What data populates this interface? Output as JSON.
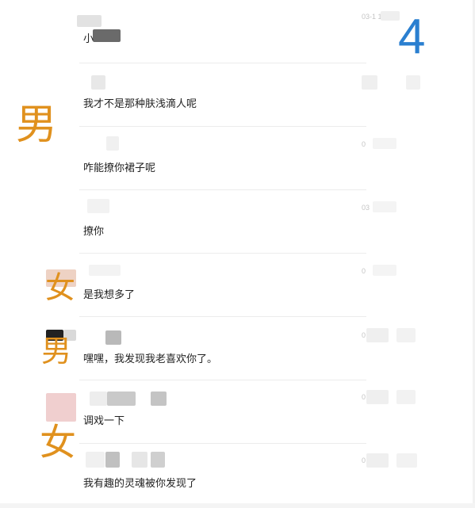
{
  "page_number": "4",
  "colors": {
    "accent_blue": "#2a7fd0",
    "label_orange": "#e0911e",
    "message_text": "#222222",
    "timestamp": "#c4c4c4",
    "separator": "#ececec"
  },
  "gender_labels": {
    "male_1": "男",
    "female_1": "女",
    "male_2": "男",
    "female_2": "女"
  },
  "messages": [
    {
      "text": "小",
      "time": "03-1  15:47"
    },
    {
      "text": "我才不是那种肤浅滴人呢",
      "time": ""
    },
    {
      "text": "咋能撩你裙子呢",
      "time": "0"
    },
    {
      "text": "撩你",
      "time": "03"
    },
    {
      "text": "是我想多了",
      "time": "0"
    },
    {
      "text": "嘿嘿，我发现我老喜欢你了。",
      "time": "0    1"
    },
    {
      "text": "调戏一下",
      "time": "0    1"
    },
    {
      "text": "我有趣的灵魂被你发现了",
      "time": "0"
    }
  ]
}
